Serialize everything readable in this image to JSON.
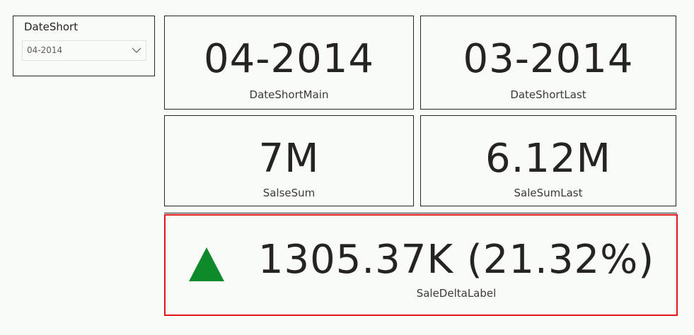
{
  "slicer": {
    "title": "DateShort",
    "selected_value": "04-2014"
  },
  "cards": {
    "date_main": {
      "value": "04-2014",
      "label": "DateShortMain"
    },
    "date_last": {
      "value": "03-2014",
      "label": "DateShortLast"
    },
    "sales_sum": {
      "value": "7M",
      "label": "SalseSum"
    },
    "sale_sum_last": {
      "value": "6.12M",
      "label": "SaleSumLast"
    },
    "delta": {
      "value": "1305.37K (21.32%)",
      "label": "SaleDeltaLabel",
      "indicator_icon": "triangle-up-icon"
    }
  },
  "colors": {
    "background": "#f8fbf8",
    "border": "#252423",
    "highlight_border": "#e0161e",
    "indicator_up": "#0f8a2a"
  }
}
